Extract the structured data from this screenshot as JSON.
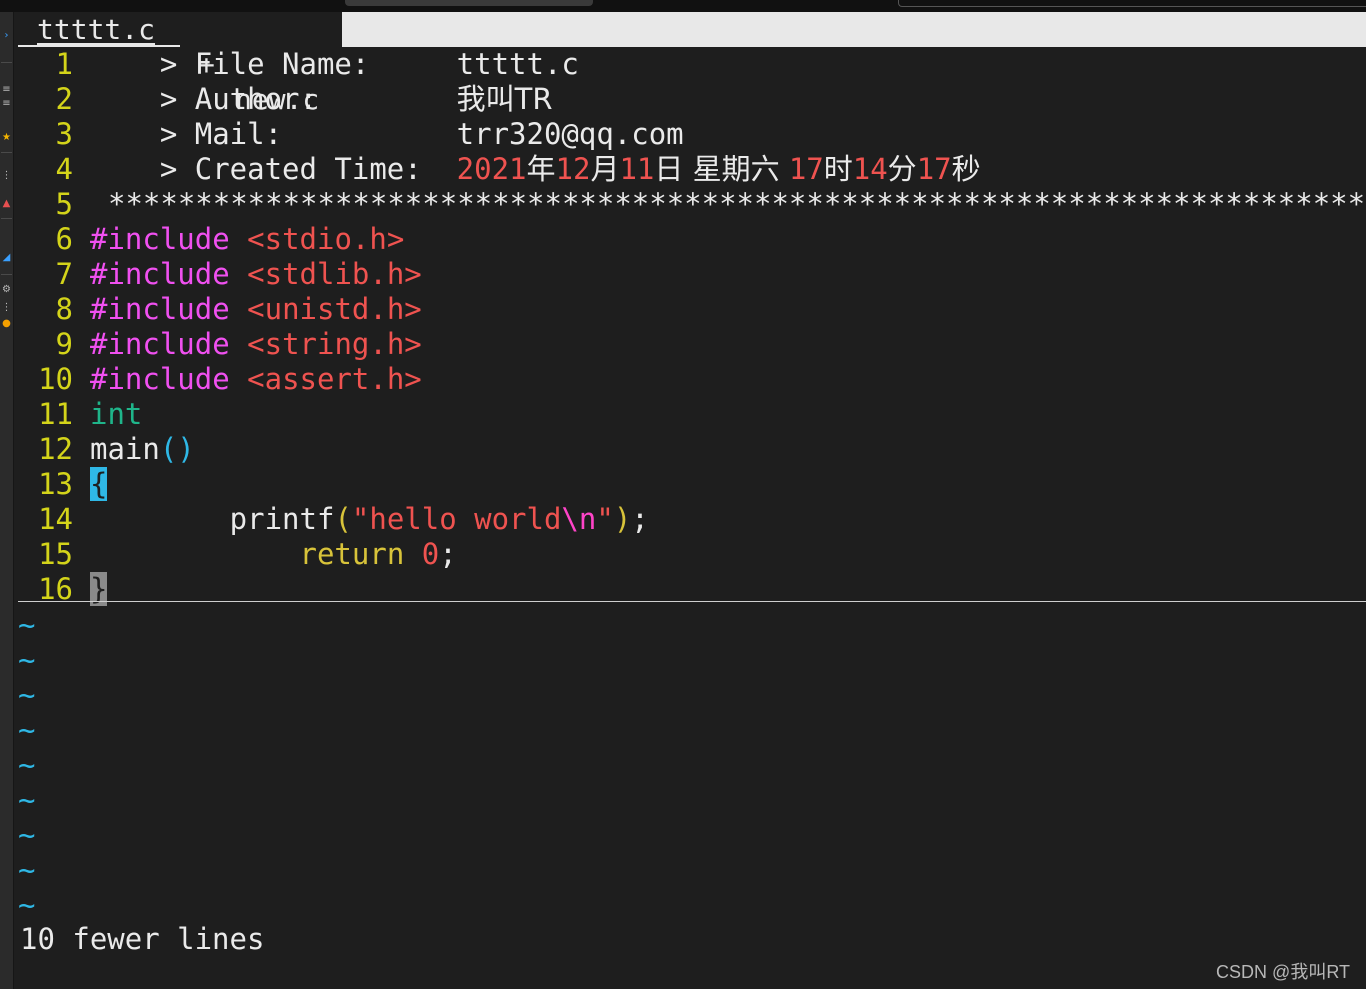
{
  "tabs": {
    "active_label": "ttttt.c",
    "inactive_modified_marker": "+",
    "inactive_label": "new.c"
  },
  "editor": {
    "lines": [
      {
        "num": "1",
        "parts": [
          {
            "t": "    > File Name:     ",
            "c": "c-white"
          },
          {
            "t": "ttttt.c",
            "c": "c-white"
          }
        ]
      },
      {
        "num": "2",
        "parts": [
          {
            "t": "    > Author:        ",
            "c": "c-white"
          },
          {
            "t": "我叫TR",
            "c": "c-white zh"
          }
        ]
      },
      {
        "num": "3",
        "parts": [
          {
            "t": "    > Mail:          ",
            "c": "c-white"
          },
          {
            "t": "trr320@qq.com",
            "c": "c-white"
          }
        ]
      },
      {
        "num": "4",
        "parts": [
          {
            "t": "    > Created Time:  ",
            "c": "c-white"
          },
          {
            "t": "2021",
            "c": "c-red"
          },
          {
            "t": "年",
            "c": "c-white zh"
          },
          {
            "t": "12",
            "c": "c-red"
          },
          {
            "t": "月",
            "c": "c-white zh"
          },
          {
            "t": "11",
            "c": "c-red"
          },
          {
            "t": "日 星期六 ",
            "c": "c-white zh"
          },
          {
            "t": "17",
            "c": "c-red"
          },
          {
            "t": "时",
            "c": "c-white zh"
          },
          {
            "t": "14",
            "c": "c-red"
          },
          {
            "t": "分",
            "c": "c-white zh"
          },
          {
            "t": "17",
            "c": "c-red"
          },
          {
            "t": "秒",
            "c": "c-white zh"
          }
        ]
      },
      {
        "num": "5",
        "star": true,
        "parts": [
          {
            "t": "****************************************************************************",
            "c": "c-white"
          }
        ]
      },
      {
        "num": "6",
        "parts": [
          {
            "t": "#include",
            "c": "c-magenta"
          },
          {
            "t": " ",
            "c": "c-white"
          },
          {
            "t": "<stdio.h>",
            "c": "c-red"
          }
        ]
      },
      {
        "num": "7",
        "parts": [
          {
            "t": "#include",
            "c": "c-magenta"
          },
          {
            "t": " ",
            "c": "c-white"
          },
          {
            "t": "<stdlib.h>",
            "c": "c-red"
          }
        ]
      },
      {
        "num": "8",
        "parts": [
          {
            "t": "#include",
            "c": "c-magenta"
          },
          {
            "t": " ",
            "c": "c-white"
          },
          {
            "t": "<unistd.h>",
            "c": "c-red"
          }
        ]
      },
      {
        "num": "9",
        "parts": [
          {
            "t": "#include",
            "c": "c-magenta"
          },
          {
            "t": " ",
            "c": "c-white"
          },
          {
            "t": "<string.h>",
            "c": "c-red"
          }
        ]
      },
      {
        "num": "10",
        "parts": [
          {
            "t": "#include",
            "c": "c-magenta"
          },
          {
            "t": " ",
            "c": "c-white"
          },
          {
            "t": "<assert.h>",
            "c": "c-red"
          }
        ]
      },
      {
        "num": "11",
        "parts": [
          {
            "t": "int",
            "c": "c-green"
          }
        ]
      },
      {
        "num": "12",
        "parts": [
          {
            "t": "main",
            "c": "c-white"
          },
          {
            "t": "()",
            "c": "c-cyan"
          }
        ]
      },
      {
        "num": "13",
        "parts": [
          {
            "t": "{",
            "c": "cursor-bg"
          }
        ]
      },
      {
        "num": "14",
        "parts": [
          {
            "t": "        printf",
            "c": "c-white"
          },
          {
            "t": "(",
            "c": "c-yellow"
          },
          {
            "t": "\"hello world",
            "c": "c-red"
          },
          {
            "t": "\\n",
            "c": "c-pink"
          },
          {
            "t": "\"",
            "c": "c-red"
          },
          {
            "t": ")",
            "c": "c-yellow"
          },
          {
            "t": ";",
            "c": "c-white"
          }
        ]
      },
      {
        "num": "15",
        "parts": [
          {
            "t": "            ",
            "c": "c-white"
          },
          {
            "t": "return",
            "c": "c-yellow"
          },
          {
            "t": " ",
            "c": "c-white"
          },
          {
            "t": "0",
            "c": "c-red"
          },
          {
            "t": ";",
            "c": "c-white"
          }
        ]
      },
      {
        "num": "16",
        "parts": [
          {
            "t": "}",
            "c": "match-bg"
          }
        ]
      }
    ],
    "empty_marker": "~",
    "empty_line_count": 9
  },
  "command_line": "10 fewer lines",
  "watermark": "CSDN @我叫RT",
  "colors": {
    "background": "#1e1e1e",
    "line_number": "#d4d41a",
    "preproc": "#f050f0",
    "string": "#ef5350",
    "type": "#1fb58a",
    "paren": "#2fb8e6",
    "statement": "#d8c33a",
    "cursor": "#2fb8e6"
  }
}
